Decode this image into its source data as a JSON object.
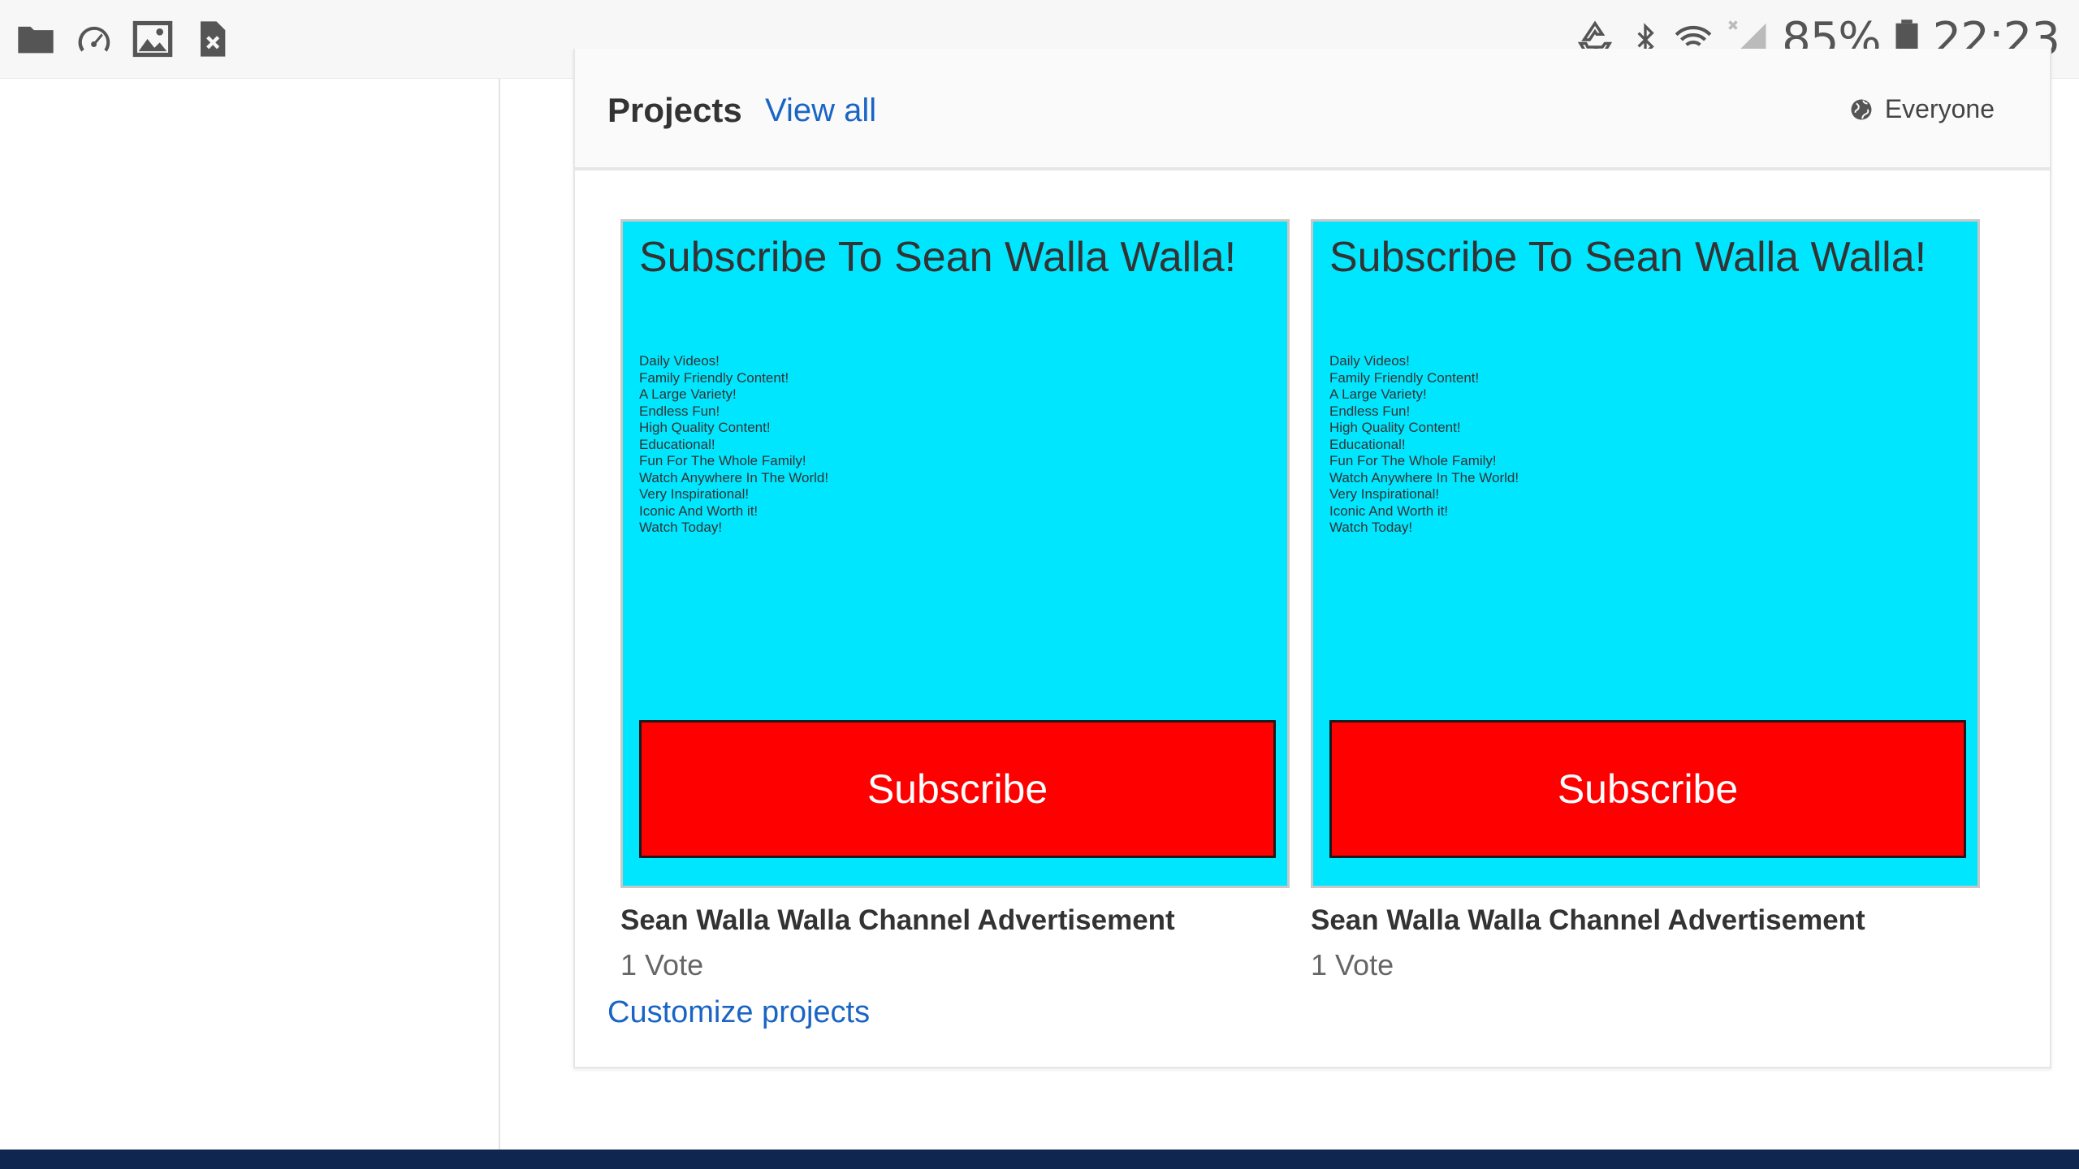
{
  "status_bar": {
    "left_icons": [
      "folder-icon",
      "speedometer-icon",
      "image-icon",
      "sim-error-icon"
    ],
    "right_icons": [
      "recycle-icon",
      "bluetooth-icon",
      "wifi-icon",
      "signal-icon",
      "battery-icon"
    ],
    "battery": "85%",
    "time": "22:23"
  },
  "projects_card": {
    "title": "Projects",
    "view_all": "View all",
    "privacy": {
      "icon": "globe-icon",
      "label": "Everyone"
    },
    "items": [
      {
        "thumbnail": {
          "heading": "Subscribe To Sean Walla Walla!",
          "lines": [
            "Daily Videos!",
            "Family Friendly Content!",
            "A Large Variety!",
            "Endless Fun!",
            "High Quality Content!",
            "Educational!",
            "Fun For The Whole Family!",
            "Watch Anywhere In The World!",
            "Very Inspirational!",
            "Iconic And Worth it!",
            "Watch Today!"
          ],
          "button": "Subscribe"
        },
        "name": "Sean Walla Walla Channel Advertisement",
        "votes": "1 Vote"
      },
      {
        "thumbnail": {
          "heading": "Subscribe To Sean Walla Walla!",
          "lines": [
            "Daily Videos!",
            "Family Friendly Content!",
            "A Large Variety!",
            "Endless Fun!",
            "High Quality Content!",
            "Educational!",
            "Fun For The Whole Family!",
            "Watch Anywhere In The World!",
            "Very Inspirational!",
            "Iconic And Worth it!",
            "Watch Today!"
          ],
          "button": "Subscribe"
        },
        "name": "Sean Walla Walla Channel Advertisement",
        "votes": "1 Vote"
      }
    ],
    "customize": "Customize projects"
  },
  "colors": {
    "link": "#1a65c4",
    "thumbnail_bg": "#00e6ff",
    "subscribe_red": "#ff0000",
    "footer": "#0f2750"
  }
}
